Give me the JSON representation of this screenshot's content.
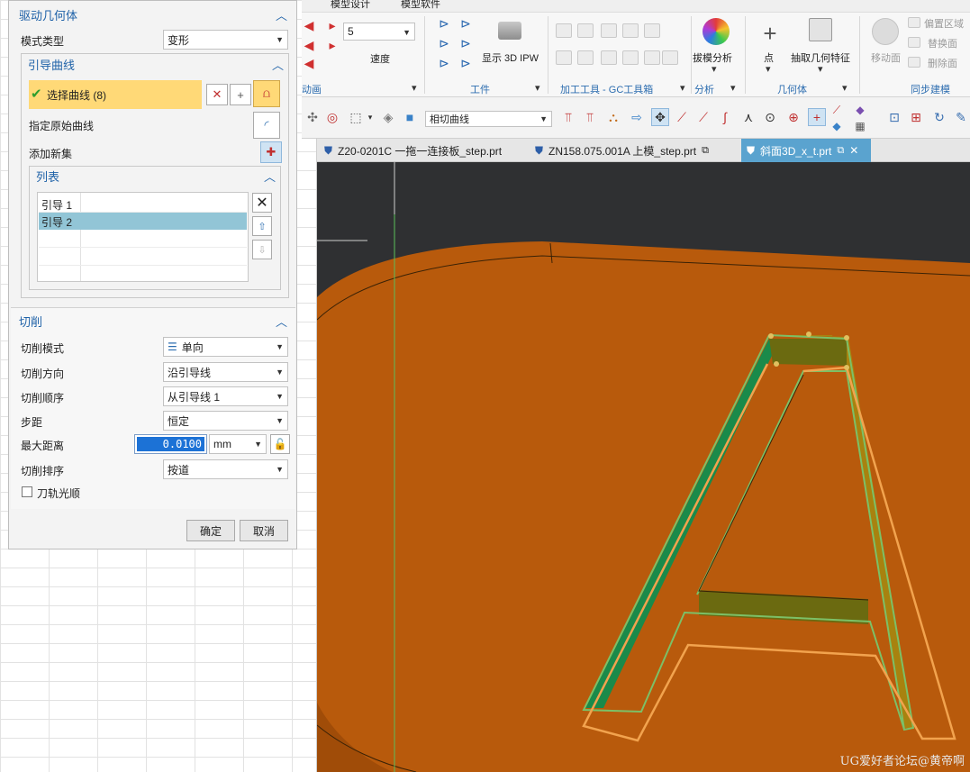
{
  "ribbon": {
    "top_labels": [
      "模型设计",
      "模型软件"
    ],
    "speed_value": "5",
    "speed_label": "速度",
    "display_3d_ipw": "显示 3D IPW",
    "draft_analysis": "拔模分析",
    "point": "点",
    "extract_geometry": "抽取几何特征",
    "move_face": "移动面",
    "offset_region": "偏置区域",
    "replace_face": "替换面",
    "delete_face": "删除面",
    "groups": {
      "animation": "动画",
      "workpiece": "工件",
      "machining_tools": "加工工具 - GC工具箱",
      "analysis": "分析",
      "geometry": "几何体",
      "sync_modeling": "同步建模"
    },
    "accent": "#2e6eb0"
  },
  "cmdbar": {
    "curve_filter": "相切曲线"
  },
  "tabs": [
    {
      "label": "Z20-0201C 一拖一连接板_step.prt"
    },
    {
      "label": "ZN158.075.001A 上模_step.prt"
    },
    {
      "label": "斜面3D_x_t.prt"
    }
  ],
  "panel": {
    "drive_geometry": {
      "title": "驱动几何体",
      "pattern_type_label": "模式类型",
      "pattern_type_value": "变形"
    },
    "guide_curves": {
      "title": "引导曲线",
      "select_curve": "选择曲线 (8)",
      "specify_origin_curve": "指定原始曲线",
      "add_new_set": "添加新集",
      "list_title": "列表",
      "list_items": [
        "引导  1",
        "引导  2"
      ]
    },
    "cut": {
      "title": "切削",
      "cut_mode_label": "切削模式",
      "cut_mode_value": "单向",
      "cut_direction_label": "切削方向",
      "cut_direction_value": "沿引导线",
      "cut_order_label": "切削顺序",
      "cut_order_value": "从引导线 1",
      "stepover_label": "步距",
      "stepover_value": "恒定",
      "max_distance_label": "最大距离",
      "max_distance_value": "0.0100",
      "max_distance_unit": "mm",
      "cut_sequence_label": "切削排序",
      "cut_sequence_value": "按道",
      "smooth_toolpath_label": "刀轨光顺"
    },
    "ok": "确定",
    "cancel": "取消"
  },
  "watermark": "UG爱好者论坛@黄帝啊",
  "colors": {
    "panel_header": "#1f62a8",
    "selection_row": "#ffd977",
    "list_selected": "#92c5d6",
    "active_tab": "#5aa3cf",
    "part_orange": "#b85a0c",
    "viewport_bg": "#2f3032"
  }
}
